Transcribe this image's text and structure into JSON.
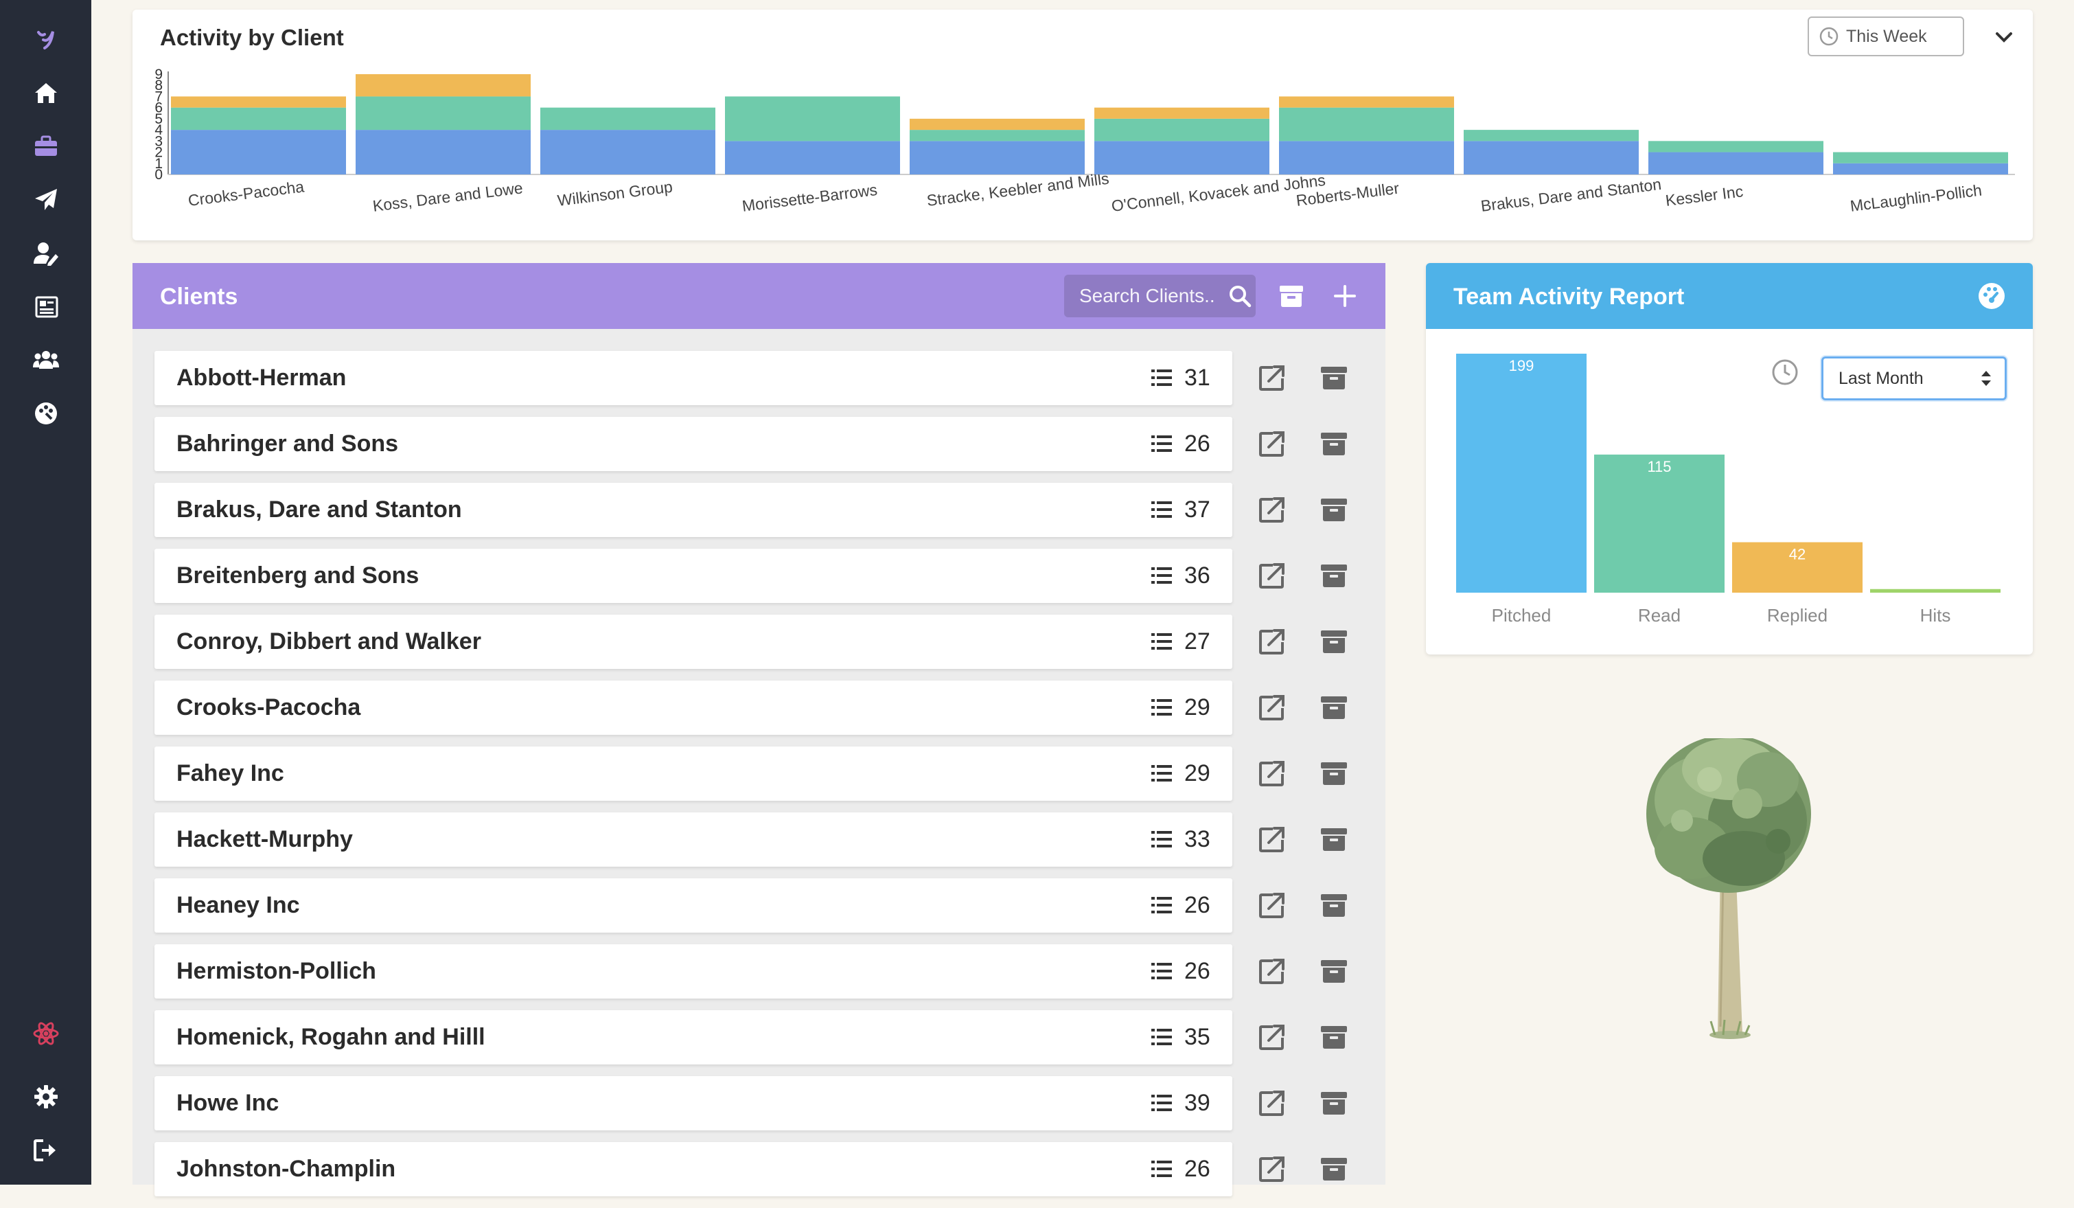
{
  "colors": {
    "sidebar_bg": "#262c38",
    "accent_purple": "#a58ee3",
    "team_blue": "#4fb2e8",
    "chart_blue": "#6b9be3",
    "chart_green": "#6fcbab",
    "chart_yellow": "#f0b955",
    "pitched": "#5bbcef",
    "read": "#6fcbab",
    "replied": "#f0b955",
    "hits": "#9fd46a"
  },
  "sidebar": {
    "items": [
      {
        "icon": "logo-icon"
      },
      {
        "icon": "home-icon"
      },
      {
        "icon": "briefcase-icon"
      },
      {
        "icon": "paper-plane-icon"
      },
      {
        "icon": "user-edit-icon"
      },
      {
        "icon": "newspaper-icon"
      },
      {
        "icon": "users-icon"
      },
      {
        "icon": "palette-icon"
      },
      {
        "icon": "atom-icon"
      },
      {
        "icon": "gear-icon"
      },
      {
        "icon": "sign-out-icon"
      }
    ]
  },
  "activity": {
    "title": "Activity by Client",
    "period": "This Week"
  },
  "clients": {
    "title": "Clients",
    "search_placeholder": "Search Clients..",
    "rows": [
      {
        "name": "Abbott-Herman",
        "count": "31"
      },
      {
        "name": "Bahringer and Sons",
        "count": "26"
      },
      {
        "name": "Brakus, Dare and Stanton",
        "count": "37"
      },
      {
        "name": "Breitenberg and Sons",
        "count": "36"
      },
      {
        "name": "Conroy, Dibbert and Walker",
        "count": "27"
      },
      {
        "name": "Crooks-Pacocha",
        "count": "29"
      },
      {
        "name": "Fahey Inc",
        "count": "29"
      },
      {
        "name": "Hackett-Murphy",
        "count": "33"
      },
      {
        "name": "Heaney Inc",
        "count": "26"
      },
      {
        "name": "Hermiston-Pollich",
        "count": "26"
      },
      {
        "name": "Homenick, Rogahn and Hilll",
        "count": "35"
      },
      {
        "name": "Howe Inc",
        "count": "39"
      },
      {
        "name": "Johnston-Champlin",
        "count": "26"
      }
    ]
  },
  "team": {
    "title": "Team Activity Report",
    "period": "Last Month"
  },
  "chart_data": [
    {
      "type": "bar",
      "stacked": true,
      "title": "Activity by Client",
      "categories": [
        "Crooks-Pacocha",
        "Koss, Dare and Lowe",
        "Wilkinson Group",
        "Morissette-Barrows",
        "Stracke, Keebler and Mills",
        "O'Connell, Kovacek and Johns",
        "Roberts-Muller",
        "Brakus, Dare and Stanton",
        "Kessler Inc",
        "McLaughlin-Pollich"
      ],
      "series": [
        {
          "color": "#6b9be3",
          "values": [
            4,
            4,
            4,
            3,
            3,
            3,
            3,
            3,
            2,
            1
          ]
        },
        {
          "color": "#6fcbab",
          "values": [
            2,
            3,
            2,
            4,
            1,
            2,
            3,
            1,
            1,
            1
          ]
        },
        {
          "color": "#f0b955",
          "values": [
            1,
            2,
            0,
            0,
            1,
            1,
            1,
            0,
            0,
            0
          ]
        }
      ],
      "yticks": [
        "0",
        "1",
        "2",
        "3",
        "4",
        "5",
        "6",
        "7",
        "8",
        "9"
      ],
      "ylim": [
        0,
        9
      ]
    },
    {
      "type": "bar",
      "categories": [
        "Pitched",
        "Read",
        "Replied",
        "Hits"
      ],
      "values": [
        199,
        115,
        42,
        3
      ],
      "labels": [
        "199",
        "115",
        "42",
        ""
      ],
      "colors": [
        "#5bbcef",
        "#6fcbab",
        "#f0b955",
        "#9fd46a"
      ],
      "ylim": [
        0,
        199
      ]
    }
  ]
}
